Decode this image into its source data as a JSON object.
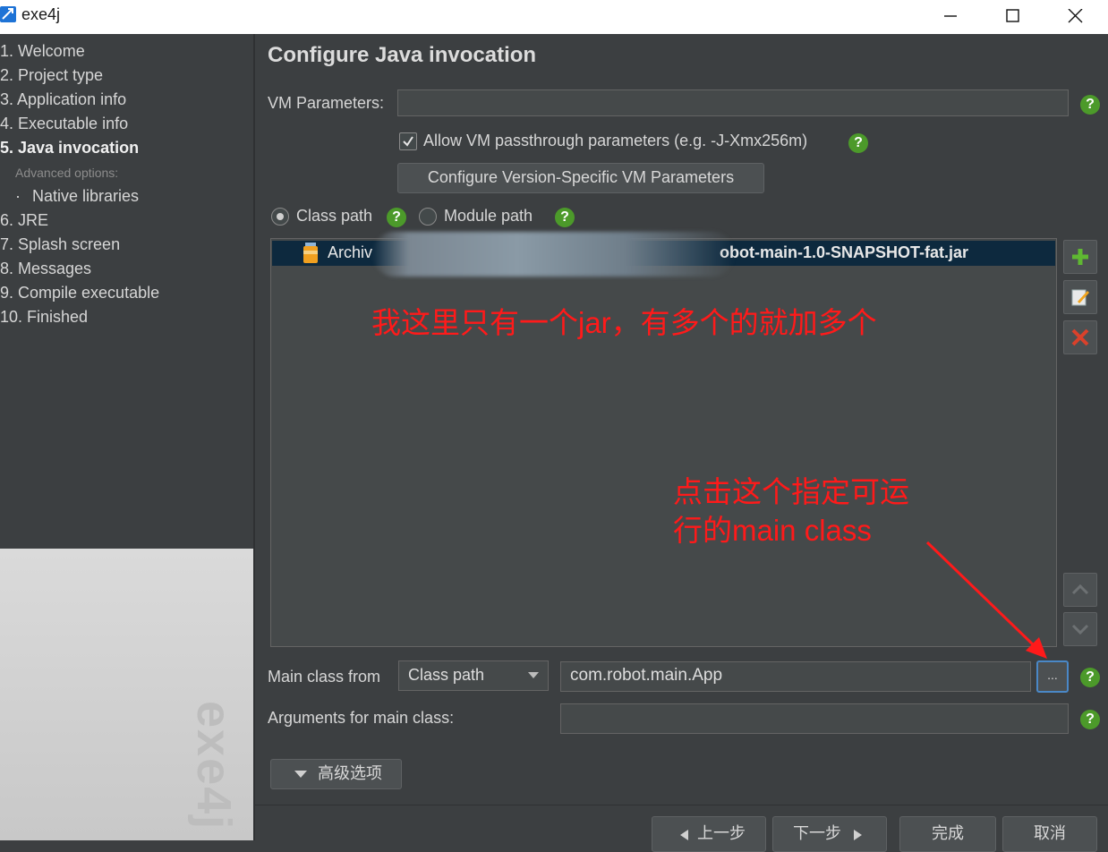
{
  "window": {
    "title": "exe4j"
  },
  "sidebar": {
    "items": [
      {
        "label": "1. Welcome"
      },
      {
        "label": "2. Project type"
      },
      {
        "label": "3. Application info"
      },
      {
        "label": "4. Executable info"
      },
      {
        "label": "5. Java invocation"
      },
      {
        "label": "Advanced options:"
      },
      {
        "label": "Native libraries"
      },
      {
        "label": "6. JRE"
      },
      {
        "label": "7. Splash screen"
      },
      {
        "label": "8. Messages"
      },
      {
        "label": "9. Compile executable"
      },
      {
        "label": "10. Finished"
      }
    ],
    "bullet": "·",
    "watermark": "exe4j"
  },
  "main": {
    "heading": "Configure Java invocation",
    "vm_parameters_label": "VM Parameters:",
    "vm_parameters_value": "",
    "allow_passthrough_label": "Allow VM passthrough parameters (e.g. -J-Xmx256m)",
    "allow_passthrough_checked": true,
    "configure_version_button": "Configure Version-Specific VM Parameters",
    "class_path_label": "Class path",
    "module_path_label": "Module path",
    "selected_path_mode": "Class path",
    "classpath_entries": [
      {
        "prefix": "Archiv",
        "suffix": "obot-main-1.0-SNAPSHOT-fat.jar"
      }
    ],
    "main_class_from_label": "Main class from",
    "main_class_from_value": "Class path",
    "main_class_value": "com.robot.main.App",
    "ellipsis_label": "...",
    "arguments_label": "Arguments for main class:",
    "arguments_value": "",
    "advanced_button": "高级选项",
    "help_glyph": "?"
  },
  "annotations": {
    "note_jar": "我这里只有一个jar，有多个的就加多个",
    "note_click_line1": "点击这个指定可运",
    "note_click_line2": "行的main class"
  },
  "footer": {
    "prev_label": "上一步",
    "next_label": "下一步",
    "finish_label": "完成",
    "cancel_label": "取消"
  },
  "colors": {
    "background": "#3c3f41",
    "annotation": "#ff1a1a",
    "help_green": "#4c9a2a",
    "selection": "#0d293e"
  }
}
